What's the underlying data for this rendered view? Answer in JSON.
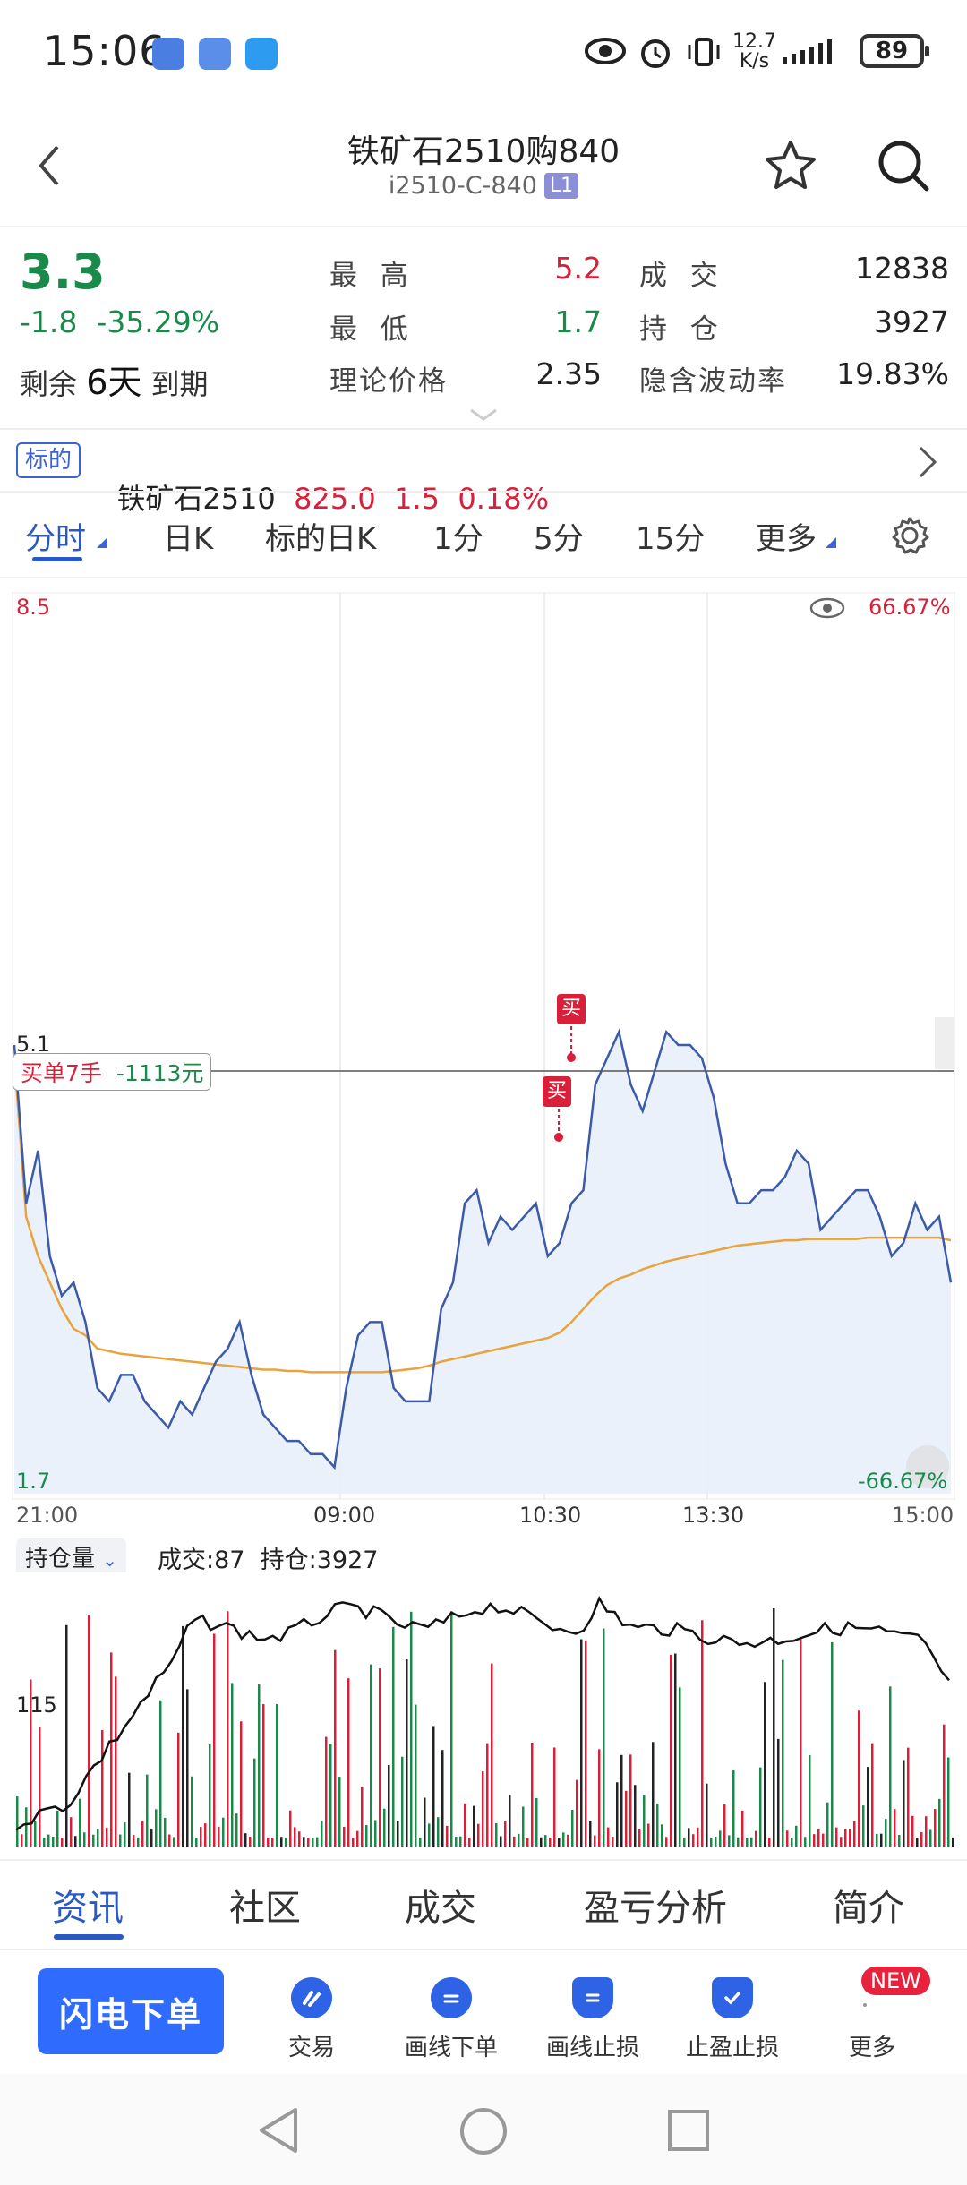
{
  "status": {
    "time": "15:06",
    "net_speed_top": "12.7",
    "net_speed_bottom": "K/s",
    "battery": "89"
  },
  "header": {
    "title": "铁矿石2510购840",
    "code": "i2510-C-840",
    "level_badge": "L1",
    "icons": [
      "back-icon",
      "star-icon",
      "search-icon"
    ]
  },
  "quote": {
    "last_price": "3.3",
    "change": "-1.8",
    "change_pct": "-35.29%",
    "remain_prefix": "剩余",
    "remain_days": "6天",
    "remain_suffix": "到期",
    "labels": {
      "high": "最  高",
      "low": "最  低",
      "theory": "理论价格",
      "volume": "成  交",
      "open_interest": "持  仓",
      "iv": "隐含波动率"
    },
    "values": {
      "high": "5.2",
      "low": "1.7",
      "theory": "2.35",
      "volume": "12838",
      "open_interest": "3927",
      "iv": "19.83%"
    }
  },
  "underlying": {
    "tag": "标的",
    "name": "铁矿石2510",
    "price": "825.0",
    "change": "1.5",
    "change_pct": "0.18%"
  },
  "tabs": [
    "分时",
    "日K",
    "标的日K",
    "1分",
    "5分",
    "15分",
    "更多"
  ],
  "chart": {
    "y_top": "8.5",
    "y_bottom": "1.7",
    "pct_top": "66.67%",
    "pct_bottom": "-66.67%",
    "ref_price_label": "5.1",
    "order_tag": "买单7手",
    "order_pnl": "-1113元",
    "buy_marker": "买",
    "x_ticks": [
      "21:00",
      "09:00",
      "10:30",
      "13:30",
      "15:00"
    ],
    "volume_selector": "持仓量",
    "volume_info": "成交:87  持仓:3927",
    "oi_label": "115",
    "colors": {
      "price": "#3b5ba9",
      "avg": "#e8a33d",
      "up": "#d8203a",
      "down": "#1a8a4a",
      "oi": "#111111"
    }
  },
  "bottom_tabs": [
    "资讯",
    "社区",
    "成交",
    "盈亏分析",
    "简介"
  ],
  "actions": {
    "flash_order": "闪电下单",
    "items": [
      "交易",
      "画线下单",
      "画线止损",
      "止盈止损",
      "更多"
    ],
    "new_badge": "NEW"
  },
  "chart_data": {
    "type": "line",
    "title": "",
    "ylim": [
      1.7,
      8.5
    ],
    "x_ticks": [
      "21:00",
      "09:00",
      "10:30",
      "13:30",
      "15:00"
    ],
    "series": [
      {
        "name": "price",
        "values": [
          5.1,
          3.9,
          4.3,
          3.5,
          3.2,
          3.3,
          3.0,
          2.5,
          2.4,
          2.6,
          2.6,
          2.4,
          2.3,
          2.2,
          2.4,
          2.3,
          2.5,
          2.7,
          2.8,
          3.0,
          2.6,
          2.3,
          2.2,
          2.1,
          2.1,
          2.0,
          2.0,
          1.9,
          2.5,
          2.9,
          3.0,
          3.0,
          2.5,
          2.4,
          2.4,
          2.4,
          3.1,
          3.3,
          3.9,
          4.0,
          3.6,
          3.8,
          3.7,
          3.8,
          3.9,
          3.5,
          3.6,
          3.9,
          4.0,
          4.8,
          5.0,
          5.2,
          4.8,
          4.6,
          4.9,
          5.2,
          5.1,
          5.1,
          5.0,
          4.7,
          4.2,
          3.9,
          3.9,
          4.0,
          4.0,
          4.1,
          4.3,
          4.2,
          3.7,
          3.8,
          3.9,
          4.0,
          4.0,
          3.8,
          3.5,
          3.6,
          3.9,
          3.7,
          3.8,
          3.3
        ]
      },
      {
        "name": "average",
        "values": [
          5.0,
          3.8,
          3.5,
          3.3,
          3.1,
          2.95,
          2.9,
          2.8,
          2.78,
          2.76,
          2.75,
          2.74,
          2.73,
          2.72,
          2.71,
          2.7,
          2.69,
          2.68,
          2.67,
          2.66,
          2.65,
          2.64,
          2.64,
          2.63,
          2.63,
          2.62,
          2.62,
          2.62,
          2.62,
          2.62,
          2.62,
          2.62,
          2.63,
          2.64,
          2.65,
          2.67,
          2.7,
          2.72,
          2.74,
          2.76,
          2.78,
          2.8,
          2.82,
          2.84,
          2.86,
          2.88,
          2.92,
          3.0,
          3.1,
          3.2,
          3.28,
          3.33,
          3.36,
          3.4,
          3.43,
          3.46,
          3.48,
          3.5,
          3.52,
          3.54,
          3.56,
          3.58,
          3.59,
          3.6,
          3.61,
          3.62,
          3.62,
          3.63,
          3.63,
          3.63,
          3.63,
          3.63,
          3.64,
          3.64,
          3.64,
          3.64,
          3.64,
          3.64,
          3.64,
          3.62
        ]
      }
    ]
  }
}
